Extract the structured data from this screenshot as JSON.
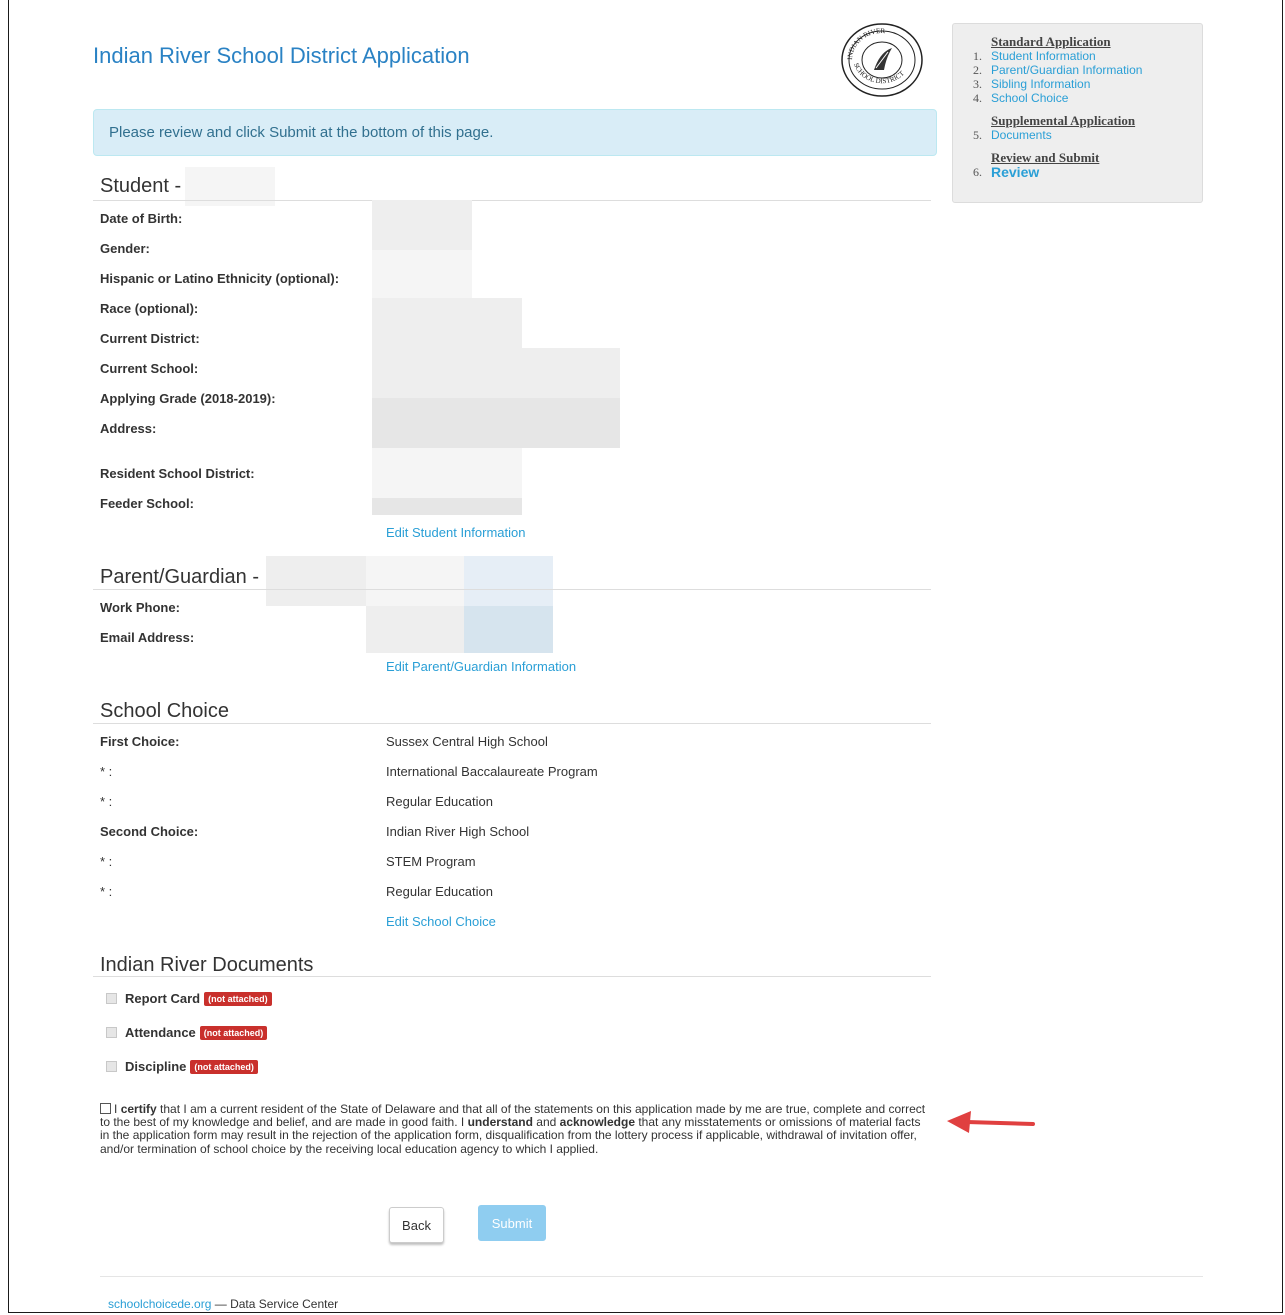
{
  "header": {
    "title": "Indian River School District Application",
    "seal_text": "INDIAN RIVER SCHOOL DISTRICT"
  },
  "alert": {
    "text": "Please review and click Submit at the bottom of this page."
  },
  "sidebar": {
    "standard_heading": "Standard Application",
    "items": [
      {
        "num": "1.",
        "label": "Student Information"
      },
      {
        "num": "2.",
        "label": "Parent/Guardian Information"
      },
      {
        "num": "3.",
        "label": "Sibling Information"
      },
      {
        "num": "4.",
        "label": "School Choice"
      }
    ],
    "supplemental_heading": "Supplemental Application",
    "supplemental_items": [
      {
        "num": "5.",
        "label": "Documents"
      }
    ],
    "review_heading": "Review and Submit",
    "review_items": [
      {
        "num": "6.",
        "label": "Review"
      }
    ]
  },
  "student": {
    "title": "Student -",
    "fields": [
      "Date of Birth:",
      "Gender:",
      "Hispanic or Latino Ethnicity (optional):",
      "Race (optional):",
      "Current District:",
      "Current School:",
      "Applying Grade (2018-2019):",
      "Address:",
      "Resident School District:",
      "Feeder School:"
    ],
    "edit_link": "Edit Student Information"
  },
  "parent": {
    "title": "Parent/Guardian -",
    "fields": [
      "Work Phone:",
      "Email Address:"
    ],
    "edit_link": "Edit Parent/Guardian Information"
  },
  "school_choice": {
    "title": "School Choice",
    "rows": [
      {
        "label": "First Choice:",
        "value": "Sussex Central High School"
      },
      {
        "label": "* :",
        "value": "International Baccalaureate Program"
      },
      {
        "label": "* :",
        "value": "Regular Education"
      },
      {
        "label": "Second Choice:",
        "value": "Indian River High School"
      },
      {
        "label": "* :",
        "value": "STEM Program"
      },
      {
        "label": "* :",
        "value": "Regular Education"
      }
    ],
    "edit_link": "Edit School Choice"
  },
  "documents": {
    "title": "Indian River Documents",
    "items": [
      {
        "label": "Report Card",
        "status": "(not attached)"
      },
      {
        "label": "Attendance",
        "status": "(not attached)"
      },
      {
        "label": "Discipline",
        "status": "(not attached)"
      }
    ]
  },
  "certify": {
    "pre": "I",
    "certify_word": "certify",
    "text1": " that I am a current resident of the State of Delaware and that all of the statements on this application made by me are true, complete and correct to the best of my knowledge and belief, and are made in good faith. I",
    "understand_word": "understand",
    "and_word": " and ",
    "acknowledge_word": "acknowledge",
    "text2": " that any misstatements or omissions of material facts in the application form may result in the rejection of the application form, disqualification from the lottery process if applicable, withdrawal of invitation offer, and/or termination of school choice by the receiving local education agency to which I applied."
  },
  "buttons": {
    "back": "Back",
    "submit": "Submit"
  },
  "footer": {
    "link": "schoolchoicede.org",
    "text": " — Data Service Center"
  },
  "colors": {
    "link": "#2a9fd6",
    "title": "#2a82c4",
    "alert_bg": "#d9edf7",
    "badge": "#c9302c",
    "arrow": "#e04040"
  }
}
